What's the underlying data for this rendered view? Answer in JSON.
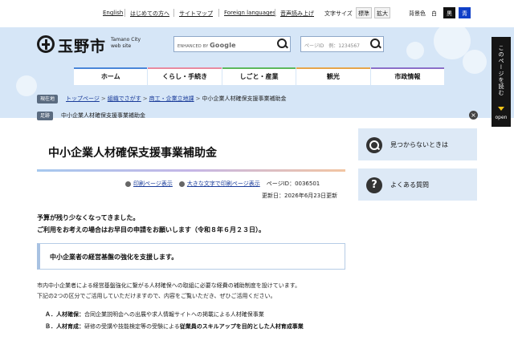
{
  "utility": {
    "english": "English",
    "first_time": "はじめての方へ",
    "sitemap": "サイトマップ",
    "foreign": "Foreign languages",
    "read_aloud": "音声読み上げ",
    "font_size_label": "文字サイズ",
    "font_standard": "標準",
    "font_large": "拡大",
    "bg_label": "背景色",
    "bg_white": "白",
    "bg_black": "黒",
    "bg_blue": "青"
  },
  "header": {
    "logo_text": "玉野市",
    "logo_sub_1": "Tamano City",
    "logo_sub_2": "web site",
    "search_google_prefix": "ENHANCED BY",
    "search_google_brand": "Google",
    "pageid_placeholder": "ページID　例：1234567"
  },
  "nav": [
    {
      "label": "ホーム",
      "color": "#4a86d8"
    },
    {
      "label": "くらし・手続き",
      "color": "#e88aa0"
    },
    {
      "label": "しごと・産業",
      "color": "#5cb85c"
    },
    {
      "label": "観光",
      "color": "#e6a54a"
    },
    {
      "label": "市政情報",
      "color": "#8a6fc8"
    }
  ],
  "breadcrumb": {
    "current_tag": "現在地",
    "top": "トップページ",
    "org": "組織でさがす",
    "dept": "商工・企業立地課",
    "current": "中小企業人材確保支援事業補助金",
    "history_tag": "足跡",
    "history_item": "中小企業人材確保支援事業補助金"
  },
  "page": {
    "title": "中小企業人材確保支援事業補助金",
    "print_link": "印刷ページ表示",
    "large_print_link": "大きな文字で印刷ページ表示",
    "page_id": "ページID：0036501",
    "updated": "更新日：2026年6月23日更新",
    "notice_1": "予算が残り少なくなってきました。",
    "notice_2": "ご利用をお考えの場合はお早目の申請をお願いします（令和８年６月２３日）。",
    "section_heading": "中小企業者の経営基盤の強化を支援します。",
    "body_1": "市内中小企業者による経営基盤強化に繋がる人材確保への取組に必要な経費の補助制度を設けています。",
    "body_2": "下記の2つの区分でご活用していただけますので、内容をご覧いただき、ぜひご活用ください。",
    "item_a_key": "Ａ．人材確保：",
    "item_a_text": "合同企業説明会への出展や求人情報サイトへの掲載による人材確保事業",
    "item_b_key": "Ｂ．人材育成：",
    "item_b_text_1": "研修の受講や技能検定等の受験による",
    "item_b_text_2": "従業員のスキルアップを目的とした人材育成事業"
  },
  "side": {
    "not_found": "見つからないときは",
    "faq": "よくある質問"
  },
  "read_banner": {
    "text": "このページを読む",
    "open": "open"
  }
}
